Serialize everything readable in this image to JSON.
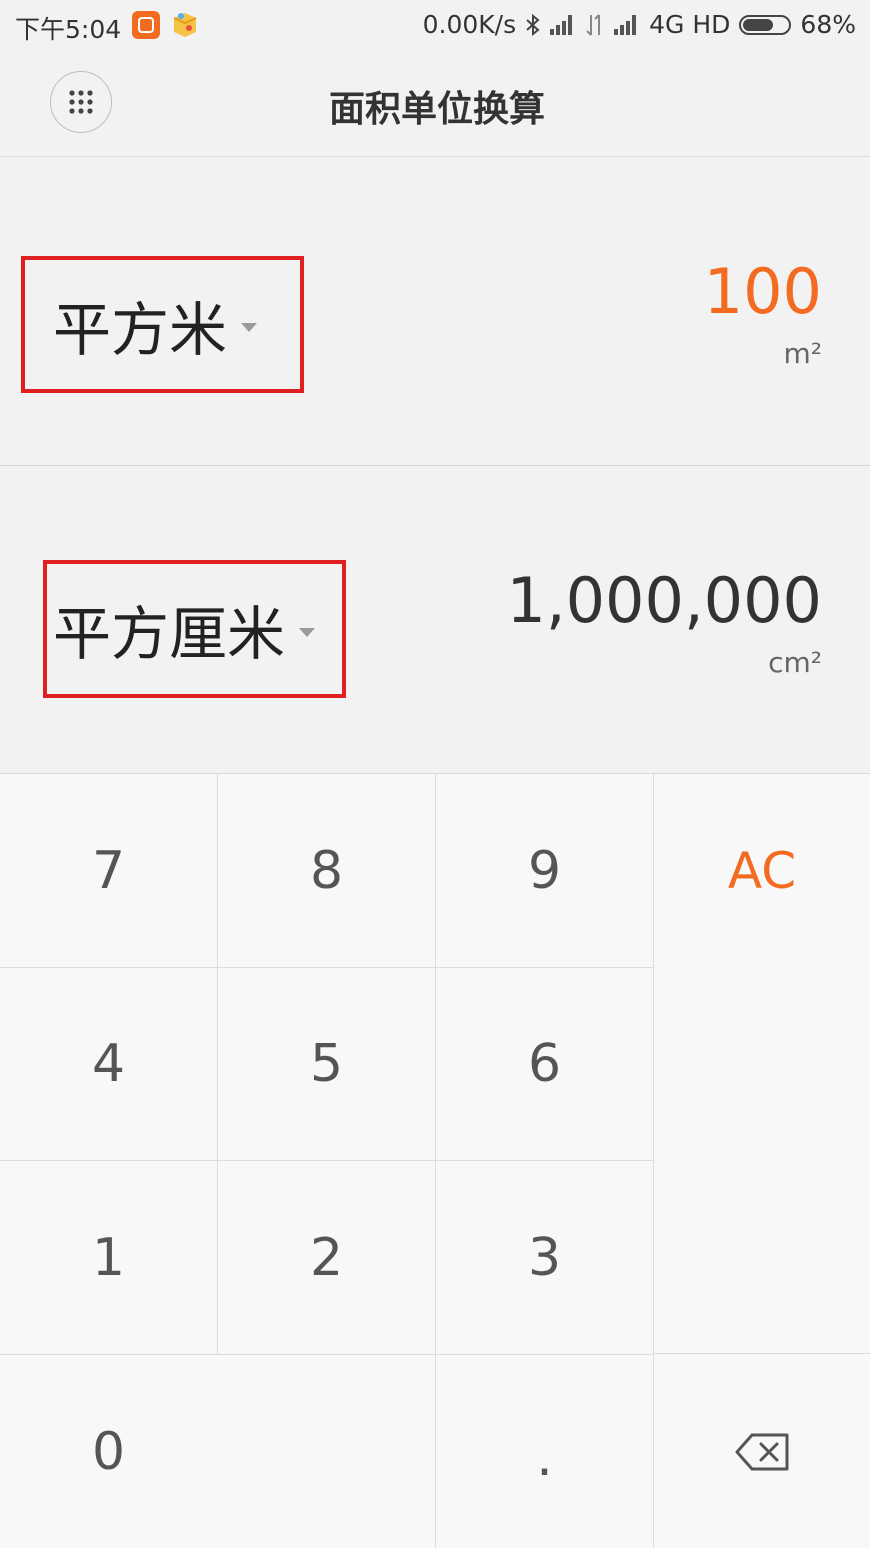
{
  "status_bar": {
    "time": "下午5:04",
    "net_speed": "0.00K/s",
    "network": "4G HD",
    "battery": "68%",
    "battery_level": 0.68
  },
  "header": {
    "title": "面积单位换算"
  },
  "converter": {
    "from": {
      "unit": "平方米",
      "value": "100",
      "symbol": "m²",
      "value_color": "#f26b21"
    },
    "to": {
      "unit": "平方厘米",
      "value": "1,000,000",
      "symbol": "cm²",
      "value_color": "#333333"
    }
  },
  "keypad": {
    "k7": "7",
    "k8": "8",
    "k9": "9",
    "k4": "4",
    "k5": "5",
    "k6": "6",
    "k1": "1",
    "k2": "2",
    "k3": "3",
    "k0": "0",
    "dot": ".",
    "clear": "AC",
    "backspace_icon": "backspace-icon"
  },
  "colors": {
    "accent": "#f26b21",
    "highlight_box": "#e02020"
  }
}
